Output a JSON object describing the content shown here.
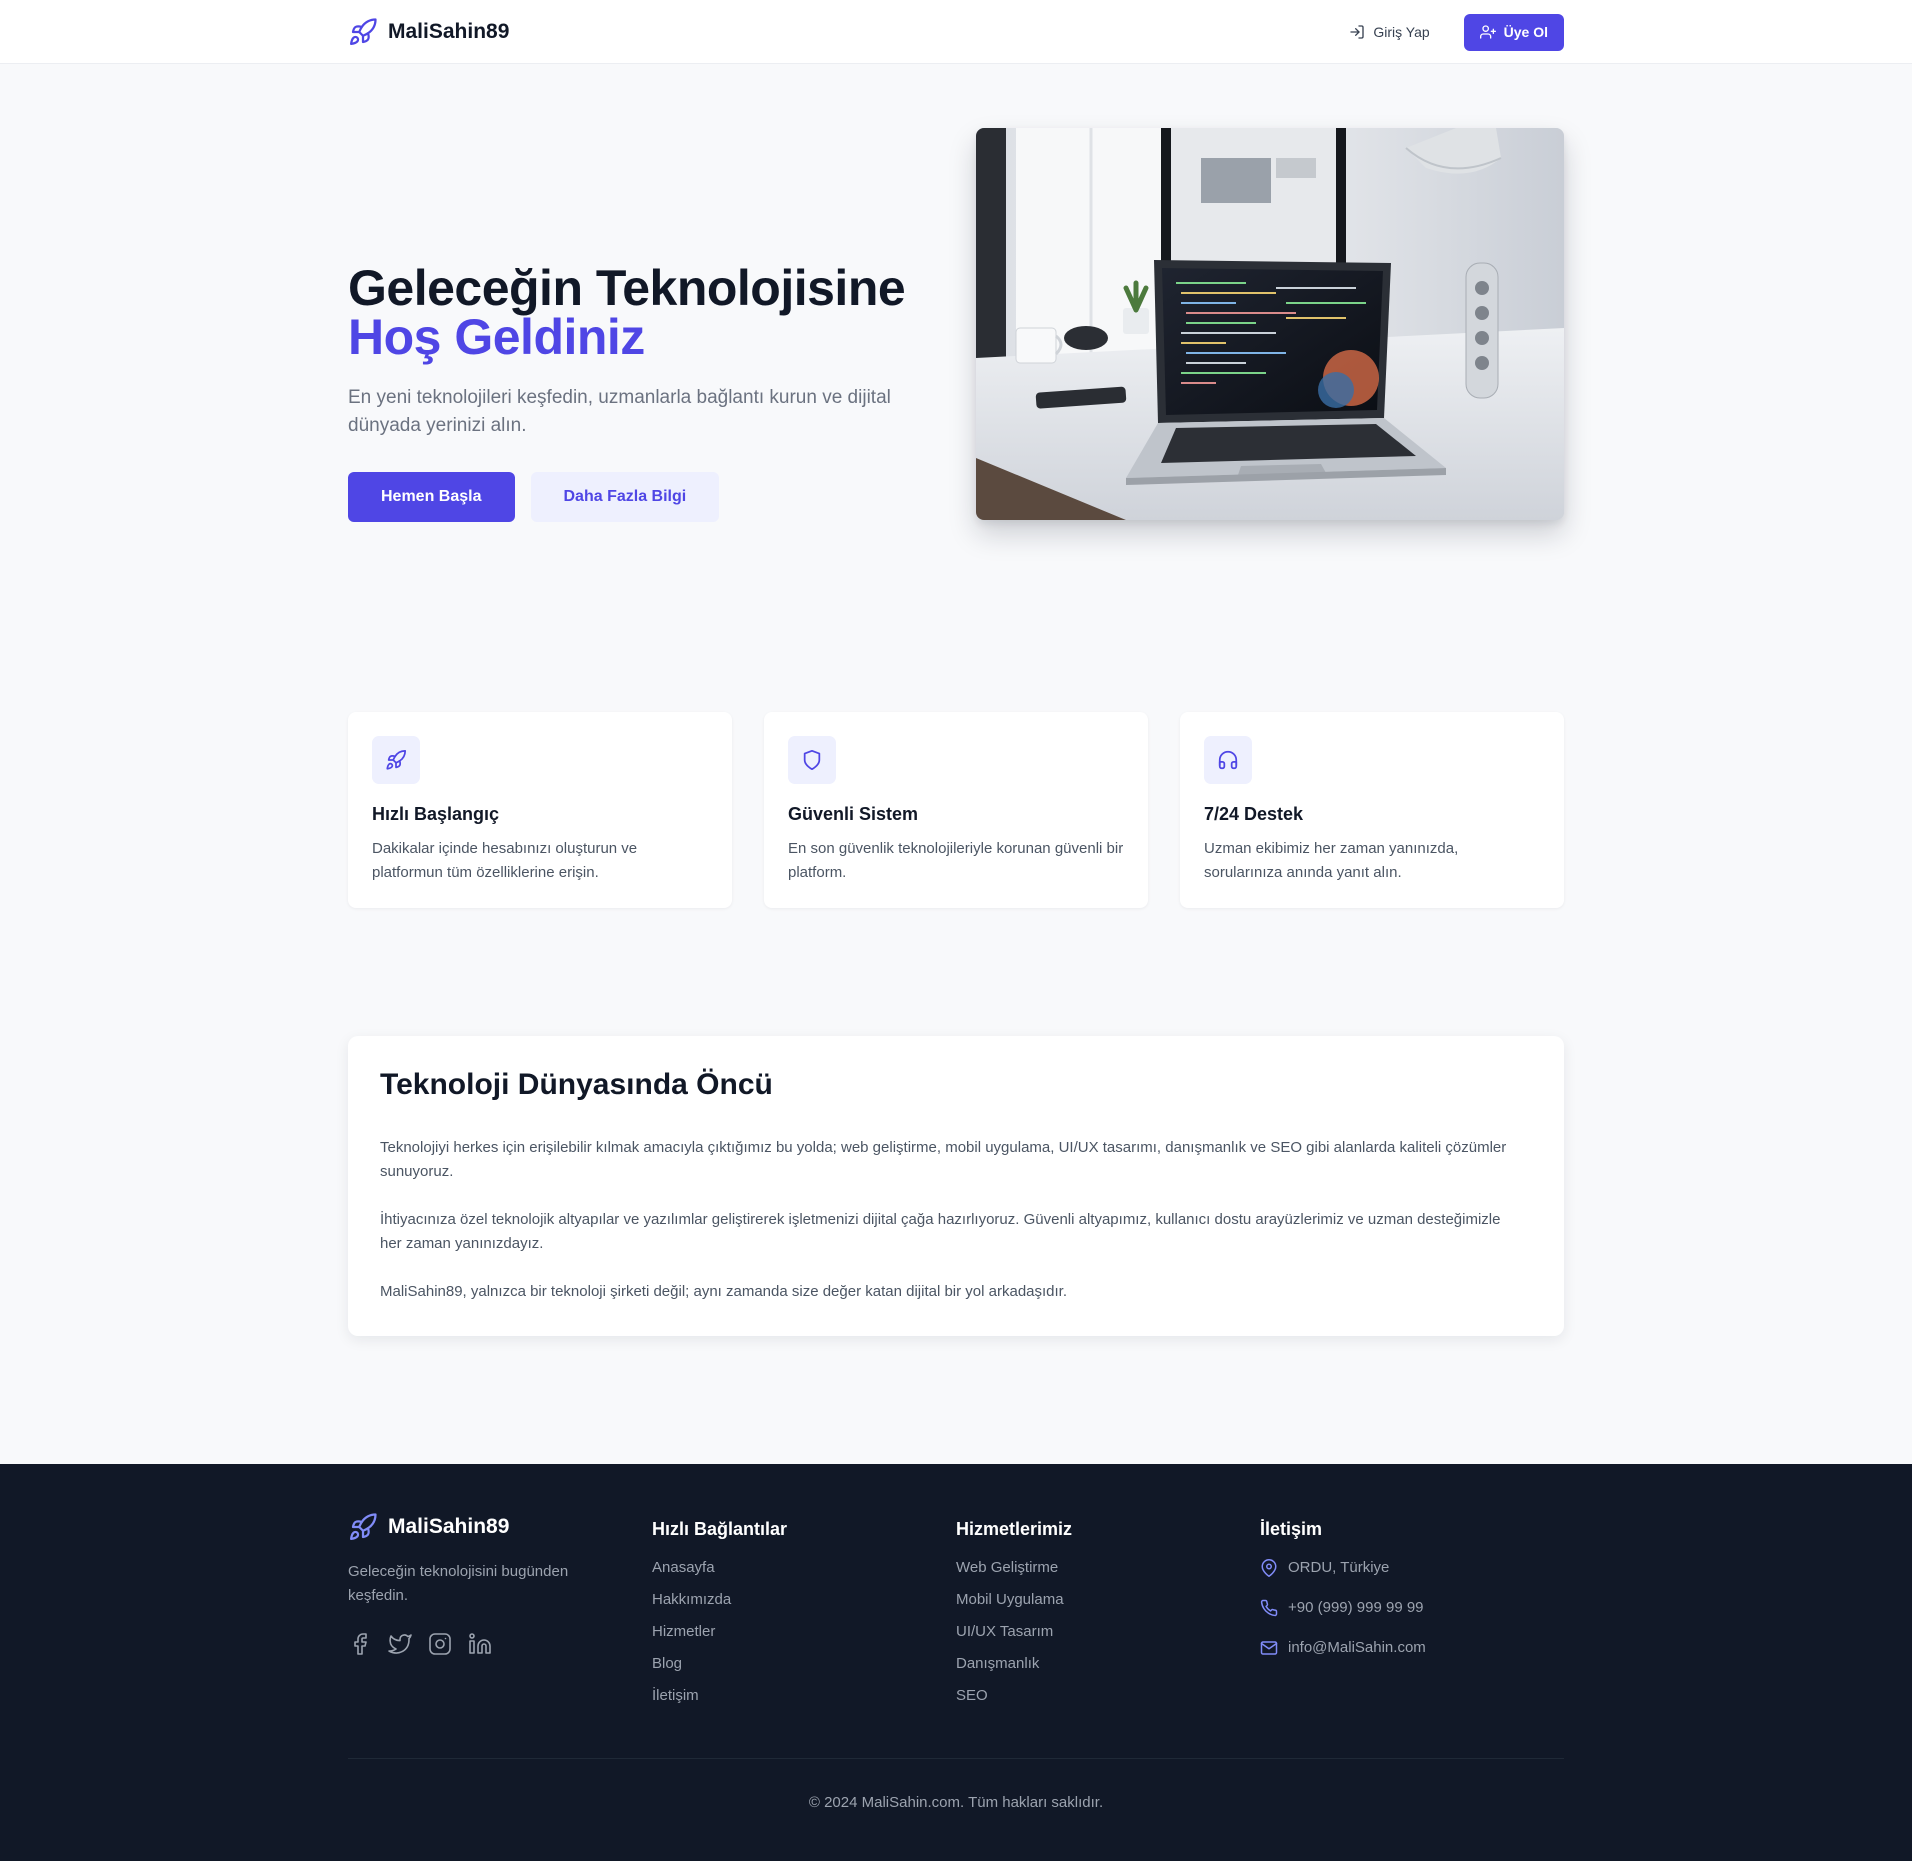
{
  "brand": {
    "name": "MaliSahin89",
    "icon": "rocket-icon",
    "accent_color": "#4f46e5"
  },
  "nav": {
    "login_label": "Giriş Yap",
    "signup_label": "Üye Ol"
  },
  "hero": {
    "title_line1": "Geleceğin Teknolojisine",
    "title_line2": "Hoş Geldiniz",
    "subtitle": "En yeni teknolojileri keşfedin, uzmanlarla bağlantı kurun ve dijital dünyada yerinizi alın.",
    "primary_button": "Hemen Başla",
    "secondary_button": "Daha Fazla Bilgi",
    "image": "laptop-on-desk-photo"
  },
  "features": [
    {
      "icon": "rocket-icon",
      "title": "Hızlı Başlangıç",
      "text": "Dakikalar içinde hesabınızı oluşturun ve platformun tüm özelliklerine erişin."
    },
    {
      "icon": "shield-icon",
      "title": "Güvenli Sistem",
      "text": "En son güvenlik teknolojileriyle korunan güvenli bir platform."
    },
    {
      "icon": "headphones-icon",
      "title": "7/24 Destek",
      "text": "Uzman ekibimiz her zaman yanınızda, sorularınıza anında yanıt alın."
    }
  ],
  "about": {
    "title": "Teknoloji Dünyasında Öncü",
    "paragraphs": [
      "Teknolojiyi herkes için erişilebilir kılmak amacıyla çıktığımız bu yolda; web geliştirme, mobil uygulama, UI/UX tasarımı, danışmanlık ve SEO gibi alanlarda kaliteli çözümler sunuyoruz.",
      "İhtiyacınıza özel teknolojik altyapılar ve yazılımlar geliştirerek işletmenizi dijital çağa hazırlıyoruz. Güvenli altyapımız, kullanıcı dostu arayüzlerimiz ve uzman desteğimizle her zaman yanınızdayız.",
      "MaliSahin89, yalnızca bir teknoloji şirketi değil; aynı zamanda size değer katan dijital bir yol arkadaşıdır."
    ]
  },
  "footer": {
    "brand_name": "MaliSahin89",
    "tagline": "Geleceğin teknolojisini bugünden keşfedin.",
    "socials": [
      "facebook-icon",
      "twitter-icon",
      "instagram-icon",
      "linkedin-icon"
    ],
    "quick_links": {
      "title": "Hızlı Bağlantılar",
      "items": [
        "Anasayfa",
        "Hakkımızda",
        "Hizmetler",
        "Blog",
        "İletişim"
      ]
    },
    "services": {
      "title": "Hizmetlerimiz",
      "items": [
        "Web Geliştirme",
        "Mobil Uygulama",
        "UI/UX Tasarım",
        "Danışmanlık",
        "SEO"
      ]
    },
    "contact": {
      "title": "İletişim",
      "address": "ORDU, Türkiye",
      "phone": "+90 (999) 999 99 99",
      "email": "info@MaliSahin.com"
    },
    "copyright": "© 2024 MaliSahin.com. Tüm hakları saklıdır."
  }
}
